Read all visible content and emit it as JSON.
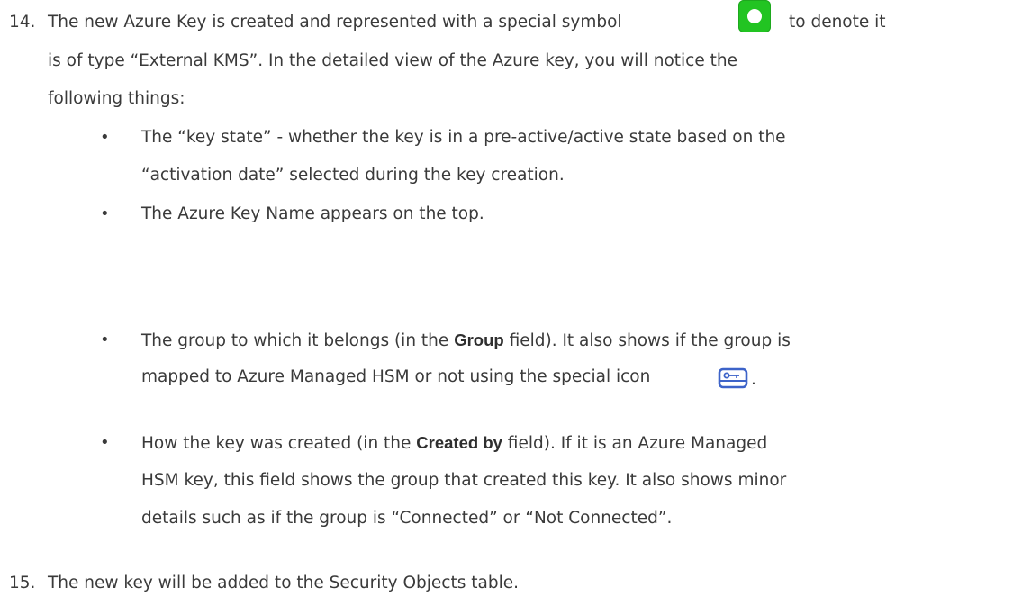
{
  "step14": {
    "number": "14.",
    "line1_before_icon": "The new Azure Key is created and represented with a special symbol",
    "line1_after_icon": "to denote it",
    "line2": "is of type “External KMS”. In the detailed view of the Azure key, you will notice the",
    "line3": "following things:",
    "icon": "external-kms-green-square-icon"
  },
  "bullets": [
    {
      "line1": "The “key state” -  whether the key is in a pre-active/active state based on the",
      "line2": "“activation date” selected during the key creation."
    },
    {
      "line1": "The Azure Key Name appears on the top."
    },
    {
      "line1_pre": "The group to which it belongs (in the ",
      "line1_bold": "Group",
      "line1_post": " field). It also shows if the group is",
      "line2": "mapped to Azure Managed HSM or not using the special icon",
      "line2_end": ".",
      "icon": "hsm-key-icon"
    },
    {
      "line1_pre": "How the key was created (in the ",
      "line1_bold": "Created by",
      "line1_post": " field). If it is an Azure Managed",
      "line2": "HSM key, this field shows the group that created this key. It also shows minor",
      "line3": "details such as if the group is “Connected” or “Not Connected”."
    }
  ],
  "step15": {
    "number": "15.",
    "text": "The new key will be added to the Security Objects table."
  },
  "bullet_char": "•",
  "colors": {
    "text": "#3a3a3a",
    "kms_green": "#22c422",
    "hsm_icon_blue": "#3d63c9"
  }
}
